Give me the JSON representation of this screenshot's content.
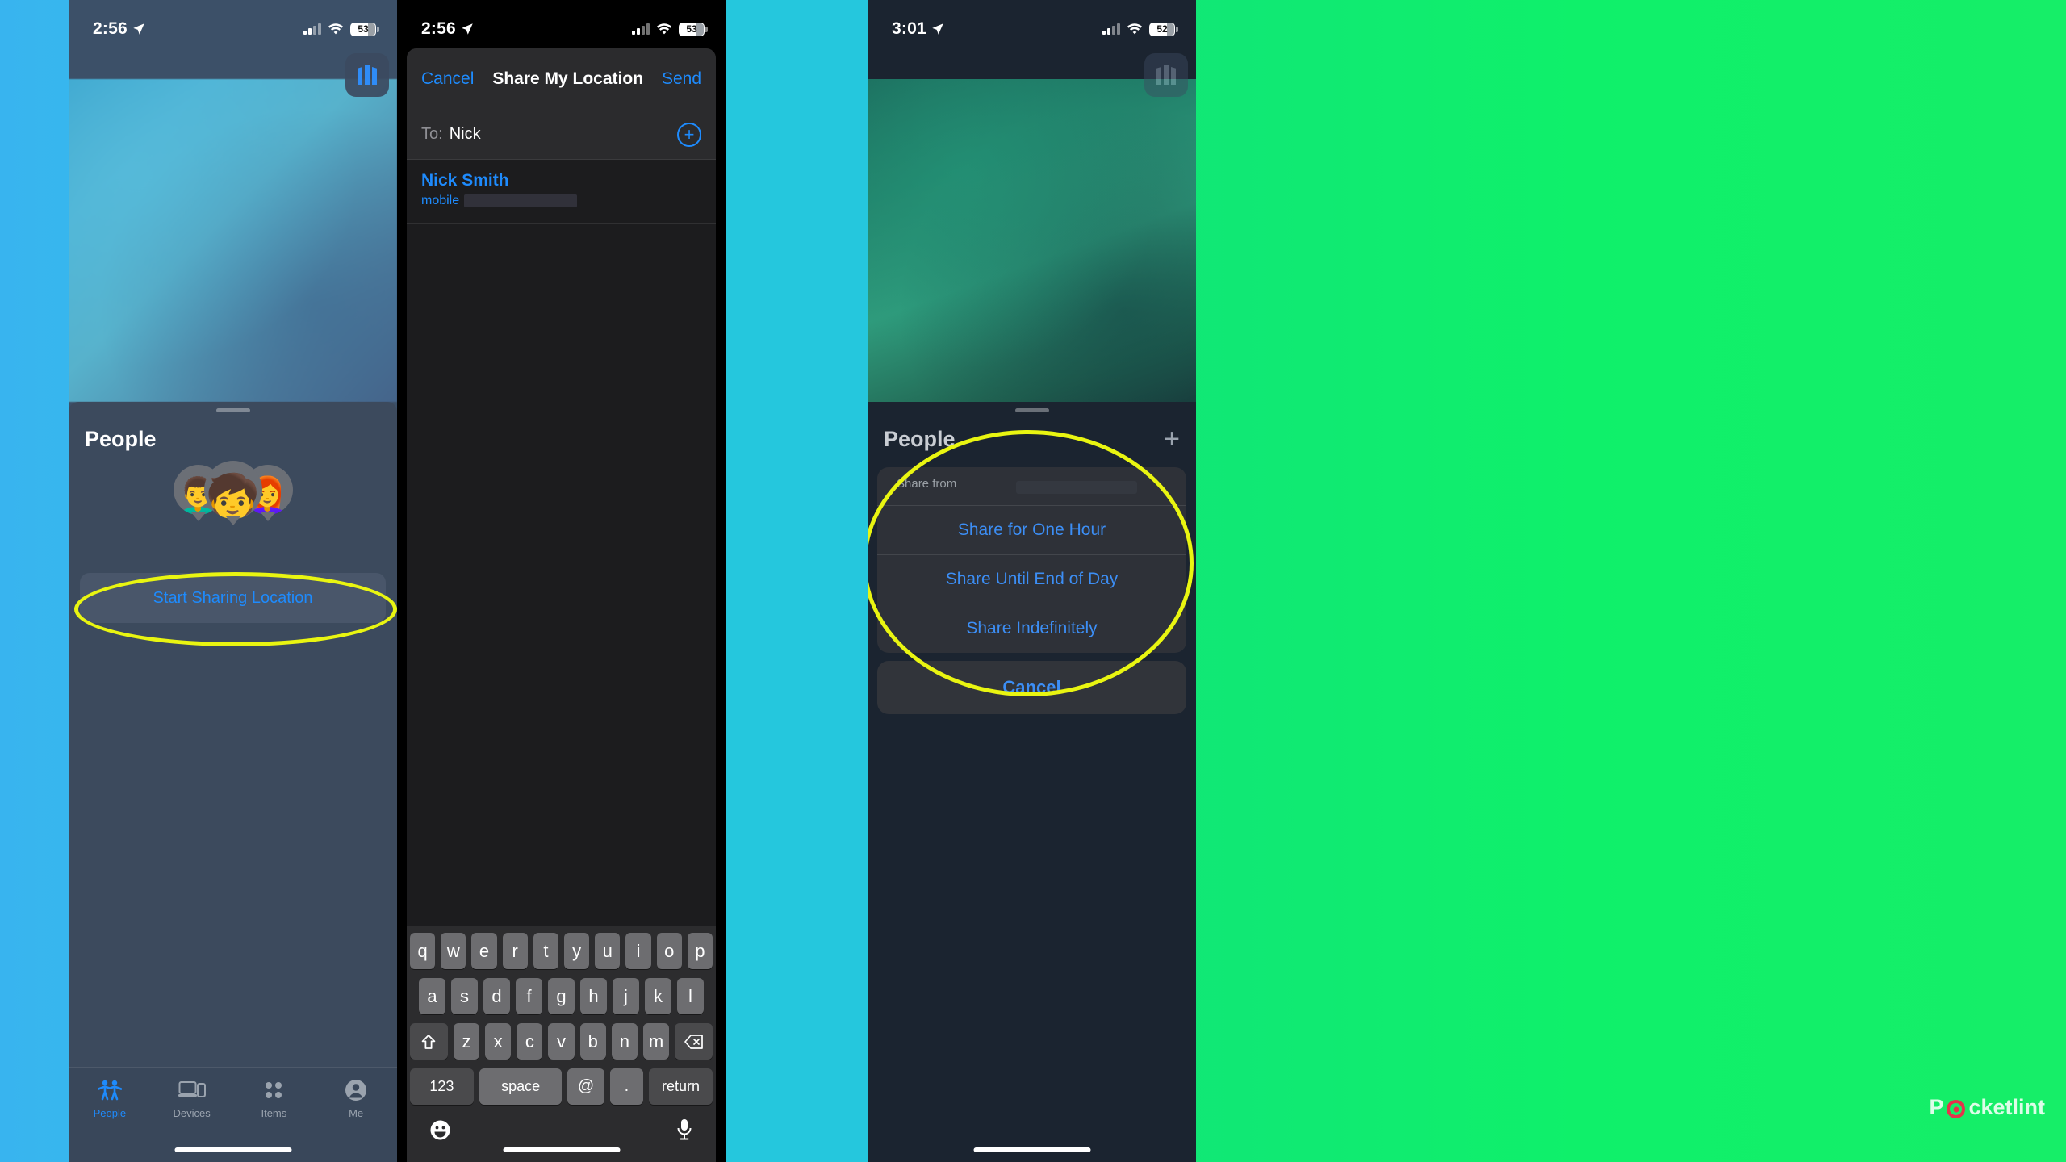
{
  "panels": [
    {
      "id": "find-my-people",
      "statusbar": {
        "time": "2:56",
        "location_icon": "location-arrow-icon",
        "signal_icon": "cellular-signal-icon",
        "wifi_icon": "wifi-icon",
        "battery": "53"
      },
      "map": {
        "layers_button_icon": "map-layers-icon"
      },
      "sheet": {
        "title": "People",
        "avatars": [
          {
            "name": "memoji-avatar-1",
            "glyph": "👨‍🦱"
          },
          {
            "name": "memoji-avatar-2",
            "glyph": "🧒"
          },
          {
            "name": "memoji-avatar-3",
            "glyph": "👩‍🦰"
          }
        ],
        "primary_button": "Start Sharing Location"
      },
      "tabbar": [
        {
          "label": "People",
          "icon": "people-icon",
          "active": true
        },
        {
          "label": "Devices",
          "icon": "devices-icon",
          "active": false
        },
        {
          "label": "Items",
          "icon": "items-grid-icon",
          "active": false
        },
        {
          "label": "Me",
          "icon": "person-circle-icon",
          "active": false
        }
      ]
    },
    {
      "id": "share-my-location-compose",
      "statusbar": {
        "time": "2:56",
        "location_icon": "location-arrow-icon",
        "signal_icon": "cellular-signal-icon",
        "wifi_icon": "wifi-icon",
        "battery": "53"
      },
      "navbar": {
        "cancel": "Cancel",
        "title": "Share My Location",
        "send": "Send"
      },
      "to_row": {
        "label": "To:",
        "value": "Nick",
        "add_contact_icon": "plus-circle-icon"
      },
      "result": {
        "name": "Nick Smith",
        "type": "mobile",
        "number_redacted": true
      },
      "keyboard": {
        "row1": [
          "q",
          "w",
          "e",
          "r",
          "t",
          "y",
          "u",
          "i",
          "o",
          "p"
        ],
        "row2": [
          "a",
          "s",
          "d",
          "f",
          "g",
          "h",
          "j",
          "k",
          "l"
        ],
        "row3_shift_icon": "shift-up-arrow-icon",
        "row3": [
          "z",
          "x",
          "c",
          "v",
          "b",
          "n",
          "m"
        ],
        "row3_delete_icon": "delete-backspace-icon",
        "row4": [
          "123",
          "space",
          "@",
          ".",
          "return"
        ],
        "emoji_icon": "emoji-smiley-icon",
        "dictation_icon": "microphone-icon"
      }
    },
    {
      "id": "share-duration-action-sheet",
      "statusbar": {
        "time": "3:01",
        "location_icon": "location-arrow-icon",
        "signal_icon": "cellular-signal-icon",
        "wifi_icon": "wifi-icon",
        "battery": "52"
      },
      "sheet": {
        "title": "People",
        "add_icon": "plus-icon"
      },
      "action_sheet": {
        "header": "Share from",
        "header_redacted": true,
        "options": [
          "Share for One Hour",
          "Share Until End of Day",
          "Share Indefinitely"
        ],
        "cancel": "Cancel"
      }
    }
  ],
  "annotations": {
    "highlight_color": "#e9f511",
    "ellipses": [
      {
        "target": "start-sharing-location-button"
      },
      {
        "target": "share-duration-options"
      }
    ]
  },
  "watermark": {
    "text_a": "P",
    "text_b": "cketlint",
    "dot_icon": "pocketlint-logo-dot"
  }
}
